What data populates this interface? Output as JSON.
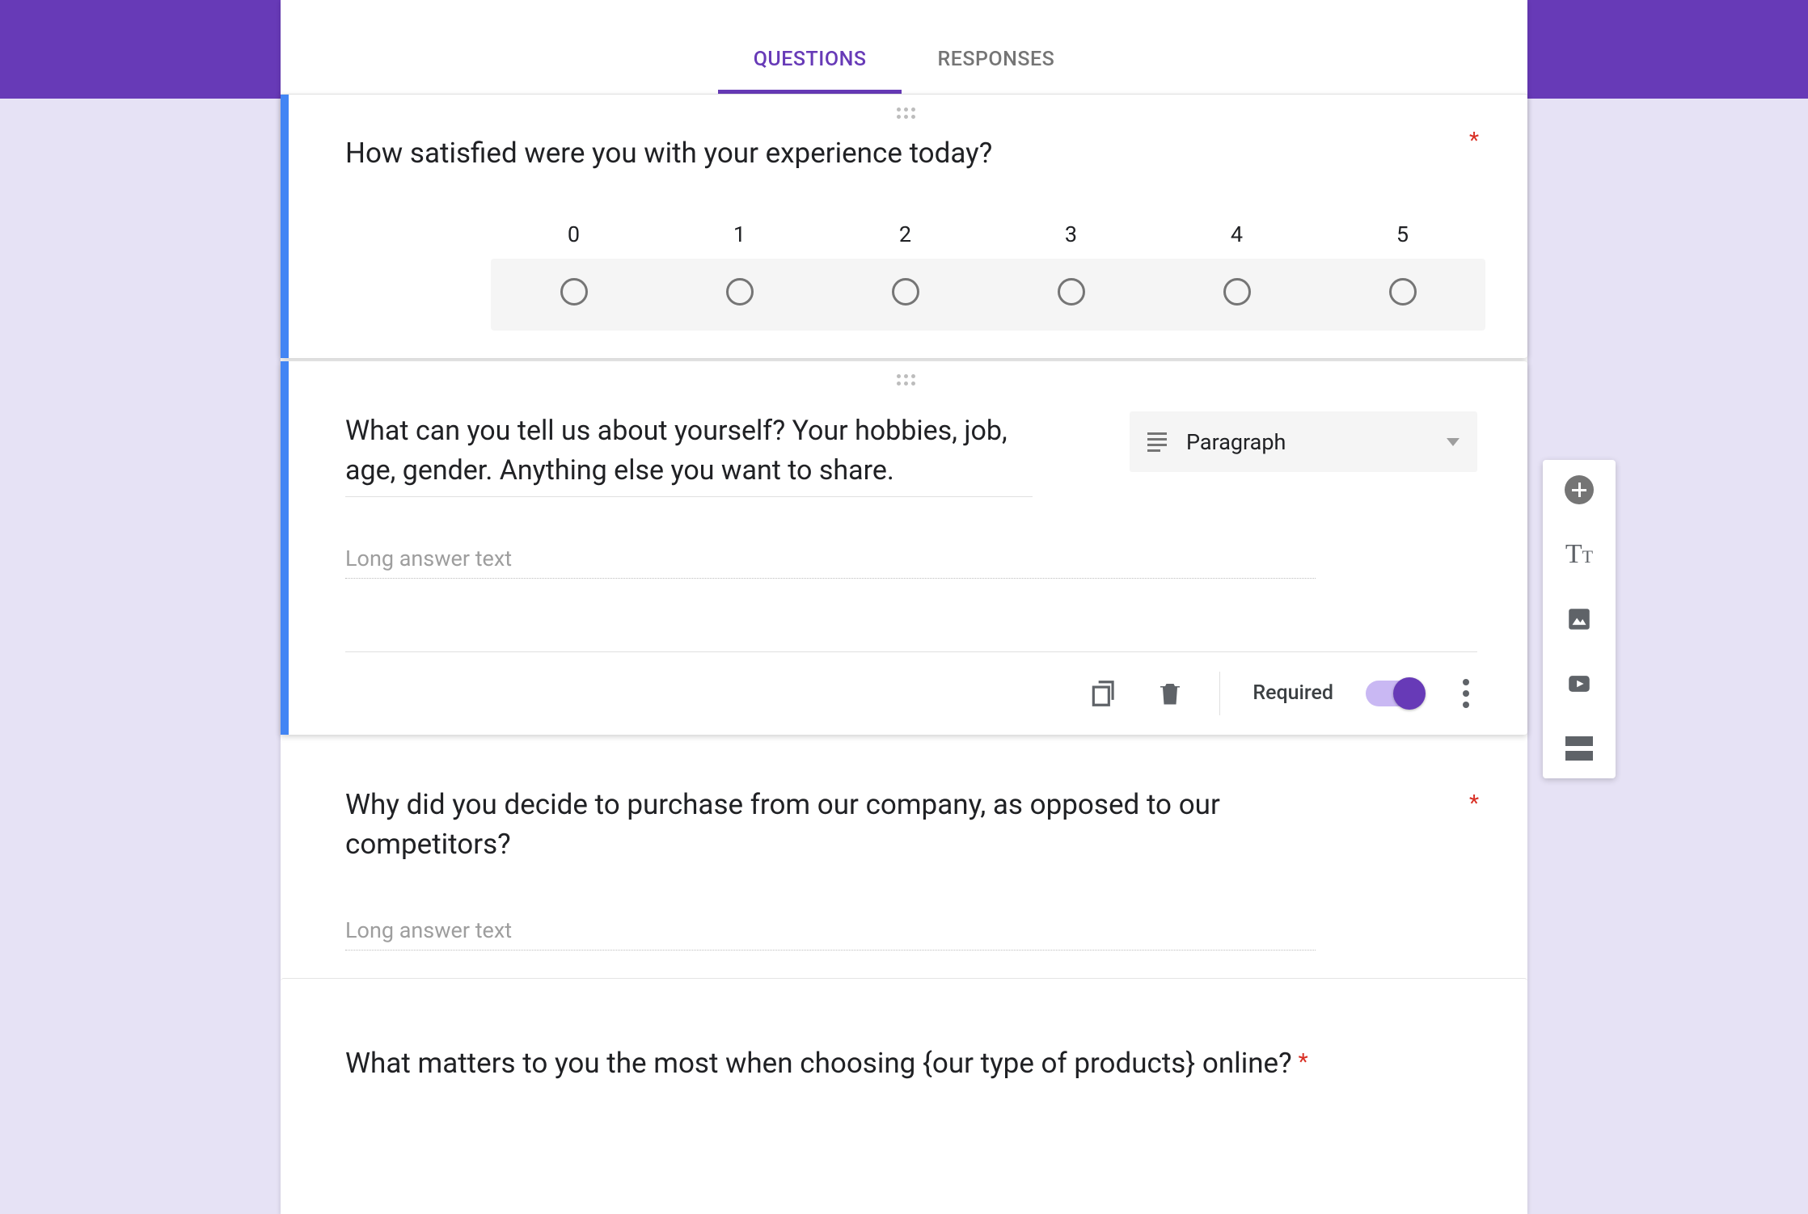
{
  "tabs": {
    "questions": "QUESTIONS",
    "responses": "RESPONSES"
  },
  "q1": {
    "title": "How satisfied were you with your experience today?",
    "required": "*",
    "scale": [
      "0",
      "1",
      "2",
      "3",
      "4",
      "5"
    ]
  },
  "q2": {
    "title": "What can you tell us about yourself? Your hobbies, job, age, gender. Anything else you want to share.",
    "type_label": "Paragraph",
    "placeholder": "Long answer text",
    "required_label": "Required"
  },
  "q3": {
    "title": "Why did you decide to purchase from our company, as opposed to our competitors?",
    "placeholder": "Long answer text",
    "required": "*"
  },
  "q4": {
    "title": "What matters to you the most when choosing {our type of products} online?",
    "required": "*"
  }
}
